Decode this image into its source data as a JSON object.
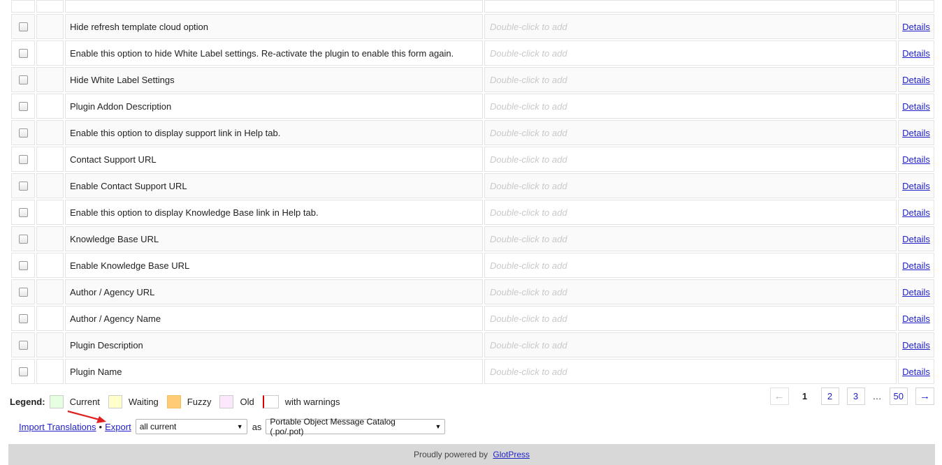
{
  "rows": [
    {
      "original": "",
      "placeholder": "",
      "action": ""
    },
    {
      "original": "Hide refresh template cloud option",
      "placeholder": "Double-click to add",
      "action": "Details"
    },
    {
      "original": "Enable this option to hide White Label settings. Re-activate the plugin to enable this form again.",
      "placeholder": "Double-click to add",
      "action": "Details"
    },
    {
      "original": "Hide White Label Settings",
      "placeholder": "Double-click to add",
      "action": "Details"
    },
    {
      "original": "Plugin Addon Description",
      "placeholder": "Double-click to add",
      "action": "Details"
    },
    {
      "original": "Enable this option to display support link in Help tab.",
      "placeholder": "Double-click to add",
      "action": "Details"
    },
    {
      "original": "Contact Support URL",
      "placeholder": "Double-click to add",
      "action": "Details"
    },
    {
      "original": "Enable Contact Support URL",
      "placeholder": "Double-click to add",
      "action": "Details"
    },
    {
      "original": "Enable this option to display Knowledge Base link in Help tab.",
      "placeholder": "Double-click to add",
      "action": "Details"
    },
    {
      "original": "Knowledge Base URL",
      "placeholder": "Double-click to add",
      "action": "Details"
    },
    {
      "original": "Enable Knowledge Base URL",
      "placeholder": "Double-click to add",
      "action": "Details"
    },
    {
      "original": "Author / Agency URL",
      "placeholder": "Double-click to add",
      "action": "Details"
    },
    {
      "original": "Author / Agency Name",
      "placeholder": "Double-click to add",
      "action": "Details"
    },
    {
      "original": "Plugin Description",
      "placeholder": "Double-click to add",
      "action": "Details"
    },
    {
      "original": "Plugin Name",
      "placeholder": "Double-click to add",
      "action": "Details"
    }
  ],
  "legend": {
    "title": "Legend:",
    "current": "Current",
    "waiting": "Waiting",
    "fuzzy": "Fuzzy",
    "old": "Old",
    "warnings": "with warnings",
    "colors": {
      "current": "#e6ffe1",
      "waiting": "#ffffcc",
      "fuzzy": "#ffcb74",
      "old": "#fde7fd",
      "warning_border": "#dd0000"
    }
  },
  "pagination": {
    "prev": "←",
    "current": "1",
    "pages": [
      "2",
      "3"
    ],
    "ellipsis": "…",
    "last": "50",
    "next": "→"
  },
  "export": {
    "import_label": "Import Translations",
    "separator": "•",
    "export_label": "Export",
    "what_value": "all current",
    "as_label": "as",
    "format_value": "Portable Object Message Catalog (.po/.pot)"
  },
  "footer": {
    "text": "Proudly powered by",
    "link": "GlotPress"
  },
  "colors": {
    "link": "#2121c8",
    "annotation_arrow": "#e02020"
  }
}
